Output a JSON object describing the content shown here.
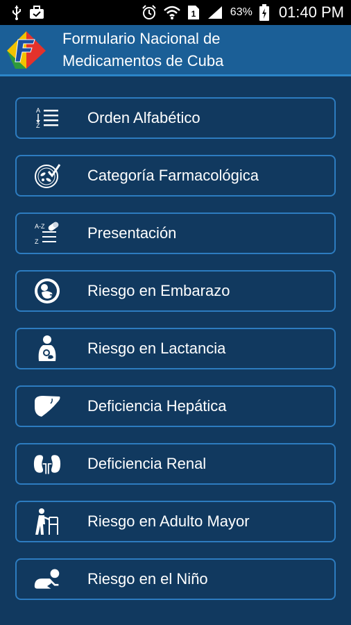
{
  "status_bar": {
    "battery_percent": "63%",
    "time": "01:40 PM",
    "icons": [
      "usb-icon",
      "briefcase-icon",
      "alarm-icon",
      "wifi-icon",
      "sim-icon",
      "signal-icon",
      "battery-charging-icon"
    ]
  },
  "header": {
    "title": "Formulario Nacional de\nMedicamentos de Cuba",
    "logo_icon": "fnm-logo-icon"
  },
  "menu": {
    "items": [
      {
        "label": "Orden Alfabético",
        "icon": "alphabetical-list-icon"
      },
      {
        "label": "Categoría Farmacológica",
        "icon": "pharmacology-category-icon"
      },
      {
        "label": "Presentación",
        "icon": "presentation-list-icon"
      },
      {
        "label": "Riesgo en Embarazo",
        "icon": "pregnancy-icon"
      },
      {
        "label": "Riesgo en Lactancia",
        "icon": "breastfeeding-icon"
      },
      {
        "label": "Deficiencia Hepática",
        "icon": "liver-icon"
      },
      {
        "label": "Deficiencia Renal",
        "icon": "kidneys-icon"
      },
      {
        "label": "Riesgo en Adulto Mayor",
        "icon": "elderly-walker-icon"
      },
      {
        "label": "Riesgo en el Niño",
        "icon": "crawling-baby-icon"
      }
    ]
  },
  "colors": {
    "background": "#11395f",
    "header": "#1b5f97",
    "button_border": "#2d7cc0",
    "text": "#ffffff"
  }
}
